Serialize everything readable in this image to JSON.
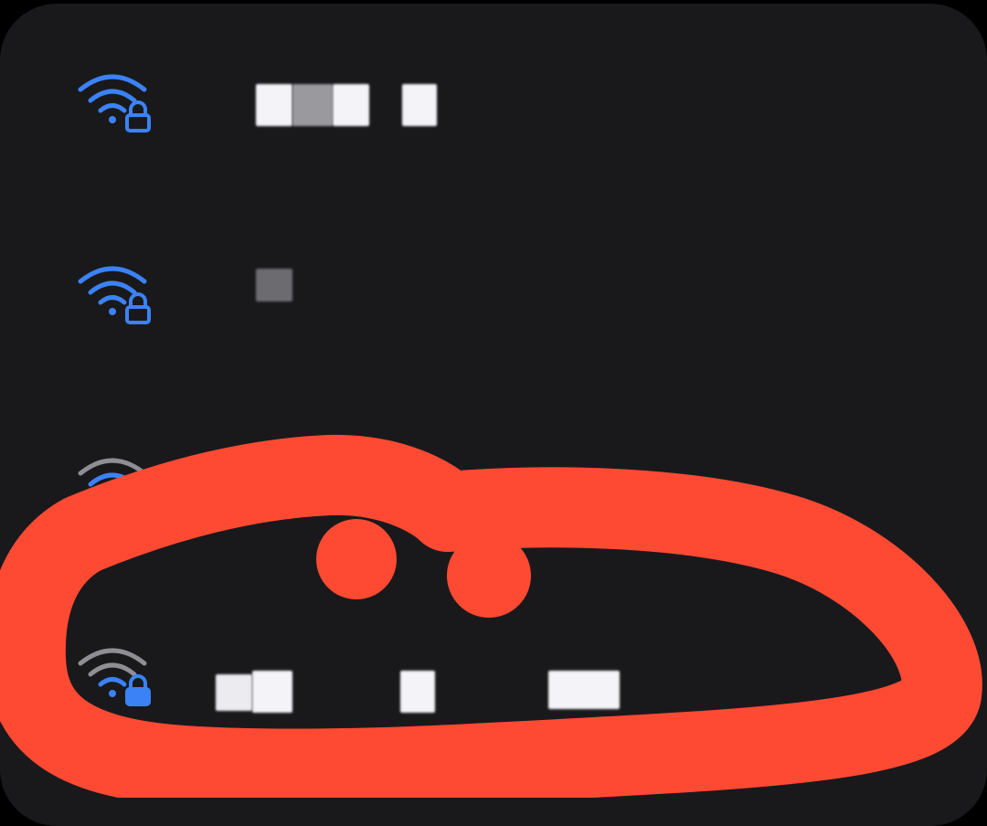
{
  "wifi_list": {
    "networks": [
      {
        "icon": "wifi-lock-icon",
        "signal": "full",
        "secured": true
      },
      {
        "icon": "wifi-lock-icon",
        "signal": "full",
        "secured": true
      },
      {
        "icon": "wifi-lock-icon",
        "signal": "partial",
        "secured": true
      },
      {
        "icon": "wifi-lock-icon",
        "signal": "weak",
        "secured": true
      }
    ]
  },
  "colors": {
    "panel_bg": "#19191c",
    "signal_active": "#3b82f6",
    "signal_inactive": "#8e8e93",
    "annotation_marker": "#ff4a33"
  },
  "annotation": {
    "type": "hand-drawn-circle",
    "highlighted_network_index": 3
  }
}
